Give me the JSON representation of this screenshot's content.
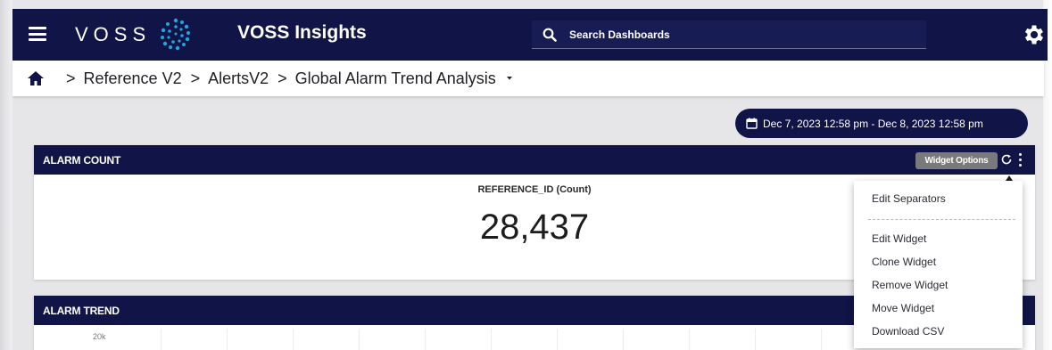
{
  "app": {
    "logo_text": "VOSS",
    "title": "VOSS Insights"
  },
  "search": {
    "placeholder": "Search Dashboards"
  },
  "breadcrumb": {
    "items": [
      "Reference V2",
      "AlertsV2",
      "Global Alarm Trend Analysis"
    ]
  },
  "date_range": {
    "label": "Dec 7, 2023 12:58 pm - Dec 8, 2023 12:58 pm"
  },
  "widgets": {
    "alarm_count": {
      "title": "ALARM COUNT",
      "metric_label": "REFERENCE_ID (Count)",
      "metric_value": "28,437",
      "options_tooltip": "Widget Options"
    },
    "alarm_trend": {
      "title": "ALARM TREND",
      "y_tick": "20k"
    }
  },
  "widget_menu": {
    "items": [
      "Edit Separators",
      "Edit Widget",
      "Clone Widget",
      "Remove Widget",
      "Move Widget",
      "Download CSV"
    ]
  },
  "colors": {
    "navy": "#101446",
    "tooltip_gray": "#7a7a7c"
  },
  "icons": {
    "menu": "hamburger-icon",
    "logo": "voss-logo-mark",
    "search": "search-icon",
    "settings": "gear-icon",
    "home": "home-icon",
    "calendar": "calendar-icon",
    "refresh": "refresh-icon",
    "more": "kebab-icon"
  }
}
